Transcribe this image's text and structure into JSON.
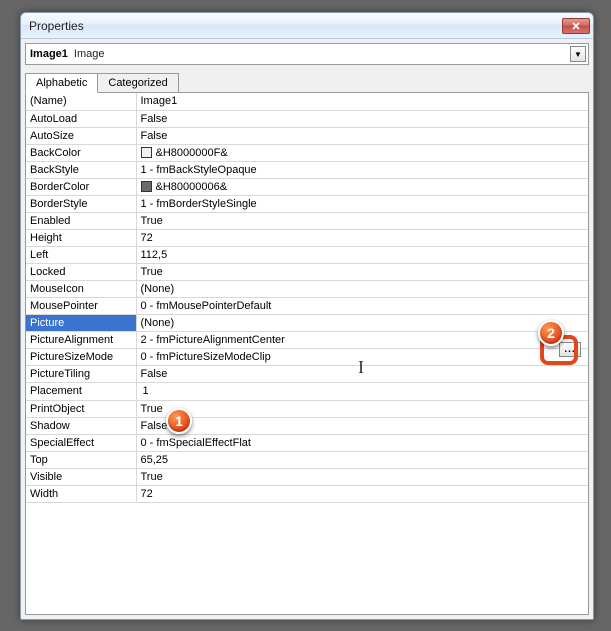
{
  "window": {
    "title": "Properties"
  },
  "object_selector": {
    "name": "Image1",
    "type": "Image"
  },
  "tabs": {
    "alpha": "Alphabetic",
    "cat": "Categorized"
  },
  "props": [
    {
      "name": "(Name)",
      "value": "Image1"
    },
    {
      "name": "AutoLoad",
      "value": "False"
    },
    {
      "name": "AutoSize",
      "value": "False"
    },
    {
      "name": "BackColor",
      "value": "&H8000000F&",
      "swatch": "#f0f0f0"
    },
    {
      "name": "BackStyle",
      "value": "1 - fmBackStyleOpaque"
    },
    {
      "name": "BorderColor",
      "value": "&H80000006&",
      "swatch": "#6a6a6a"
    },
    {
      "name": "BorderStyle",
      "value": "1 - fmBorderStyleSingle"
    },
    {
      "name": "Enabled",
      "value": "True"
    },
    {
      "name": "Height",
      "value": "72"
    },
    {
      "name": "Left",
      "value": "112,5"
    },
    {
      "name": "Locked",
      "value": "True"
    },
    {
      "name": "MouseIcon",
      "value": "(None)"
    },
    {
      "name": "MousePointer",
      "value": "0 - fmMousePointerDefault"
    },
    {
      "name": "Picture",
      "value": "(None)",
      "selected": true
    },
    {
      "name": "PictureAlignment",
      "value": "2 - fmPictureAlignmentCenter"
    },
    {
      "name": "PictureSizeMode",
      "value": "0 - fmPictureSizeModeClip"
    },
    {
      "name": "PictureTiling",
      "value": "False"
    },
    {
      "name": "Placement",
      "value": "1",
      "editing": true
    },
    {
      "name": "PrintObject",
      "value": "True"
    },
    {
      "name": "Shadow",
      "value": "False"
    },
    {
      "name": "SpecialEffect",
      "value": "0 - fmSpecialEffectFlat"
    },
    {
      "name": "Top",
      "value": "65,25"
    },
    {
      "name": "Visible",
      "value": "True"
    },
    {
      "name": "Width",
      "value": "72"
    }
  ],
  "ellipsis": "...",
  "callouts": {
    "c1": "1",
    "c2": "2"
  }
}
